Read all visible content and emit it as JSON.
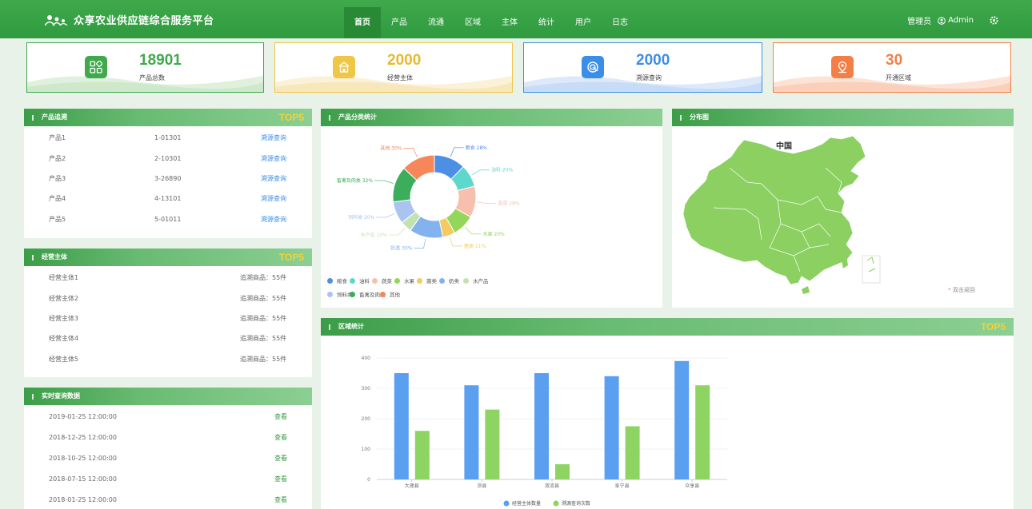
{
  "header": {
    "title": "众享农业供应链综合服务平台",
    "nav": [
      "首页",
      "产品",
      "流通",
      "区域",
      "主体",
      "统计",
      "用户",
      "日志"
    ],
    "active_index": 0,
    "role": "管理员",
    "user": "Admin"
  },
  "stats": [
    {
      "value": "18901",
      "label": "产品总数",
      "color": "#3fa94c",
      "icon": "grid-icon"
    },
    {
      "value": "2000",
      "label": "经营主体",
      "color": "#f0c647",
      "icon": "house-icon"
    },
    {
      "value": "2000",
      "label": "溯源查询",
      "color": "#3b8ee8",
      "icon": "radar-icon"
    },
    {
      "value": "30",
      "label": "开通区域",
      "color": "#f47f46",
      "icon": "location-icon"
    }
  ],
  "products": {
    "title": "产品追溯",
    "badge": "TOP5",
    "rows": [
      {
        "name": "产品1",
        "code": "1-01301",
        "action": "溯源查询"
      },
      {
        "name": "产品2",
        "code": "2-10301",
        "action": "溯源查询"
      },
      {
        "name": "产品3",
        "code": "3-26890",
        "action": "溯源查询"
      },
      {
        "name": "产品4",
        "code": "4-13101",
        "action": "溯源查询"
      },
      {
        "name": "产品5",
        "code": "5-01011",
        "action": "溯源查询"
      }
    ]
  },
  "entities": {
    "title": "经营主体",
    "badge": "TOP5",
    "rows": [
      {
        "name": "经营主体1",
        "info": "追溯商品：55件"
      },
      {
        "name": "经营主体2",
        "info": "追溯商品：55件"
      },
      {
        "name": "经营主体3",
        "info": "追溯商品：55件"
      },
      {
        "name": "经营主体4",
        "info": "追溯商品：55件"
      },
      {
        "name": "经营主体5",
        "info": "追溯商品：55件"
      }
    ]
  },
  "queries": {
    "title": "实时查询数据",
    "rows": [
      {
        "time": "2019-01-25 12:00:00",
        "action": "查看"
      },
      {
        "time": "2018-12-25 12:00:00",
        "action": "查看"
      },
      {
        "time": "2018-10-25 12:00:00",
        "action": "查看"
      },
      {
        "time": "2018-07-15 12:00:00",
        "action": "查看"
      },
      {
        "time": "2018-01-25 12:00:00",
        "action": "查看"
      }
    ]
  },
  "category_panel": {
    "title": "产品分类统计"
  },
  "map_panel": {
    "title": "分布图",
    "map_title": "中国",
    "back_label": "双击返回",
    "back_marker": "*"
  },
  "region_panel": {
    "title": "区域统计",
    "badge": "TOP5"
  },
  "chart_data": [
    {
      "type": "pie",
      "donut": true,
      "slices": [
        {
          "name": "粮食",
          "value": 28,
          "label": "粮食  28%",
          "color": "#4e8fe6"
        },
        {
          "name": "油料",
          "value": 20,
          "label": "油料  20%",
          "color": "#5ed8cc"
        },
        {
          "name": "蔬菜",
          "value": 28,
          "label": "蔬菜  28%",
          "color": "#f8bfae"
        },
        {
          "name": "水果",
          "value": 20,
          "label": "水果  20%",
          "color": "#93d65a"
        },
        {
          "name": "菌类",
          "value": 11,
          "label": "菌类  11%",
          "color": "#f4cb60"
        },
        {
          "name": "奶类",
          "value": 30,
          "label": "奶类  30%",
          "color": "#82b3ef"
        },
        {
          "name": "水产品",
          "value": 10,
          "label": "水产品  10%",
          "color": "#c3e2b1"
        },
        {
          "name": "饲料类",
          "value": 20,
          "label": "饲料类  20%",
          "color": "#a9c5ef"
        },
        {
          "name": "畜禽及肉类",
          "value": 32,
          "label": "畜禽及肉类  32%",
          "color": "#3aae5b"
        },
        {
          "name": "其他",
          "value": 30,
          "label": "其他  30%",
          "color": "#f5875b"
        }
      ],
      "legend": [
        "粮食",
        "油料",
        "蔬菜",
        "水果",
        "菌类",
        "奶类",
        "水产品",
        "饲料类",
        "畜禽及肉类",
        "其他"
      ]
    },
    {
      "type": "bar",
      "categories": [
        "大理县",
        "凉县",
        "双流县",
        "阜宁县",
        "众享县"
      ],
      "series": [
        {
          "name": "经营主体数量",
          "values": [
            350,
            310,
            350,
            340,
            390
          ],
          "color": "#5a9ff0"
        },
        {
          "name": "溯源查询次数",
          "values": [
            160,
            230,
            50,
            175,
            310
          ],
          "color": "#8ed463"
        }
      ],
      "ylim": [
        0,
        400
      ],
      "yticks": [
        "0",
        "100",
        "200",
        "300",
        "400"
      ],
      "grid": true,
      "legend": "bottom"
    }
  ]
}
